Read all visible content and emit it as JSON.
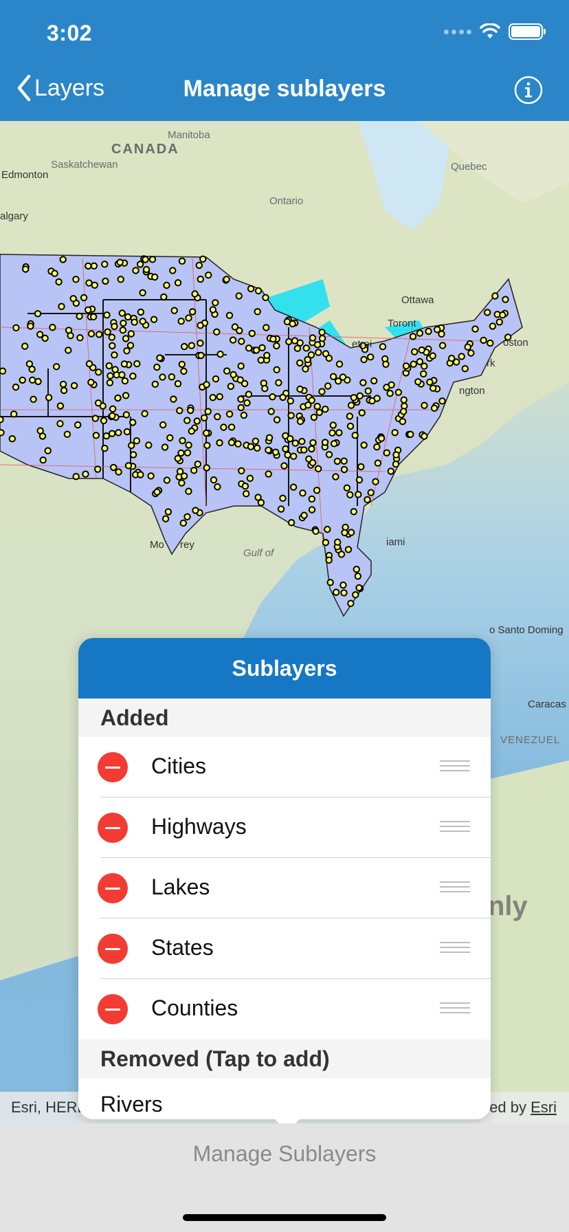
{
  "status_bar": {
    "time": "3:02"
  },
  "nav": {
    "back_label": "Layers",
    "title": "Manage sublayers",
    "info_icon": "info-icon"
  },
  "map": {
    "labels": [
      "CANADA",
      "Manitoba",
      "Saskatchewan",
      "Edmonton",
      "algary",
      "Ontario",
      "Quebec",
      "Ottawa",
      "Toront",
      "etroi",
      "oston",
      "rk",
      "ngton",
      "Mo",
      "rey",
      "Gulf of",
      "iami",
      "o Santo Doming",
      "Caracas",
      "VENEZUEL",
      "nly"
    ],
    "attribution_left": "Esri, HERE",
    "attribution_right_prefix": "ed by ",
    "attribution_right_link": "Esri"
  },
  "popover": {
    "title": "Sublayers",
    "added_header": "Added",
    "added": [
      "Cities",
      "Highways",
      "Lakes",
      "States",
      "Counties"
    ],
    "removed_header": "Removed (Tap to add)",
    "removed": [
      "Rivers"
    ]
  },
  "toolbar": {
    "label": "Manage Sublayers"
  },
  "colors": {
    "nav": "#2a86c8",
    "popover_header": "#1677c4",
    "delete": "#f23c33",
    "us_fill": "#b8c4f5",
    "city": "#ffff66"
  }
}
